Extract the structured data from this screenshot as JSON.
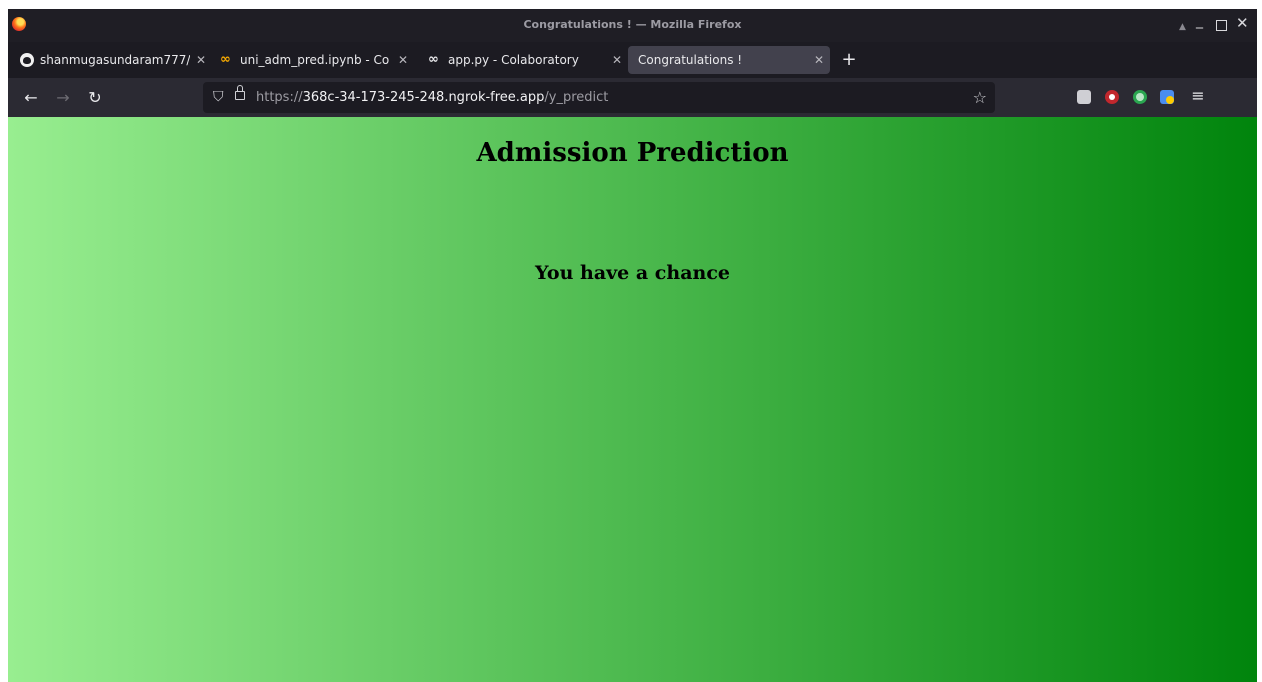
{
  "window": {
    "title": "Congratulations ! — Mozilla Firefox"
  },
  "tabs": [
    {
      "title": "shanmugasundaram777/",
      "favicon": "github-icon",
      "active": false
    },
    {
      "title": "uni_adm_pred.ipynb - Co",
      "favicon": "colab-icon",
      "active": false
    },
    {
      "title": "app.py - Colaboratory",
      "favicon": "colab-icon",
      "active": false
    },
    {
      "title": "Congratulations !",
      "favicon": "",
      "active": true
    }
  ],
  "navbar": {
    "url_scheme": "https://",
    "url_host": "368c-34-173-245-248.ngrok-free.app",
    "url_path": "/y_predict"
  },
  "page": {
    "heading": "Admission Prediction",
    "result": "You have a chance",
    "gradient_start": "#98ee90",
    "gradient_end": "#00840c"
  },
  "colors": {
    "titlebar": "#1f1e25",
    "navbar": "#2b2a33",
    "urlbar": "#1c1b22",
    "active_tab": "#42414d"
  }
}
